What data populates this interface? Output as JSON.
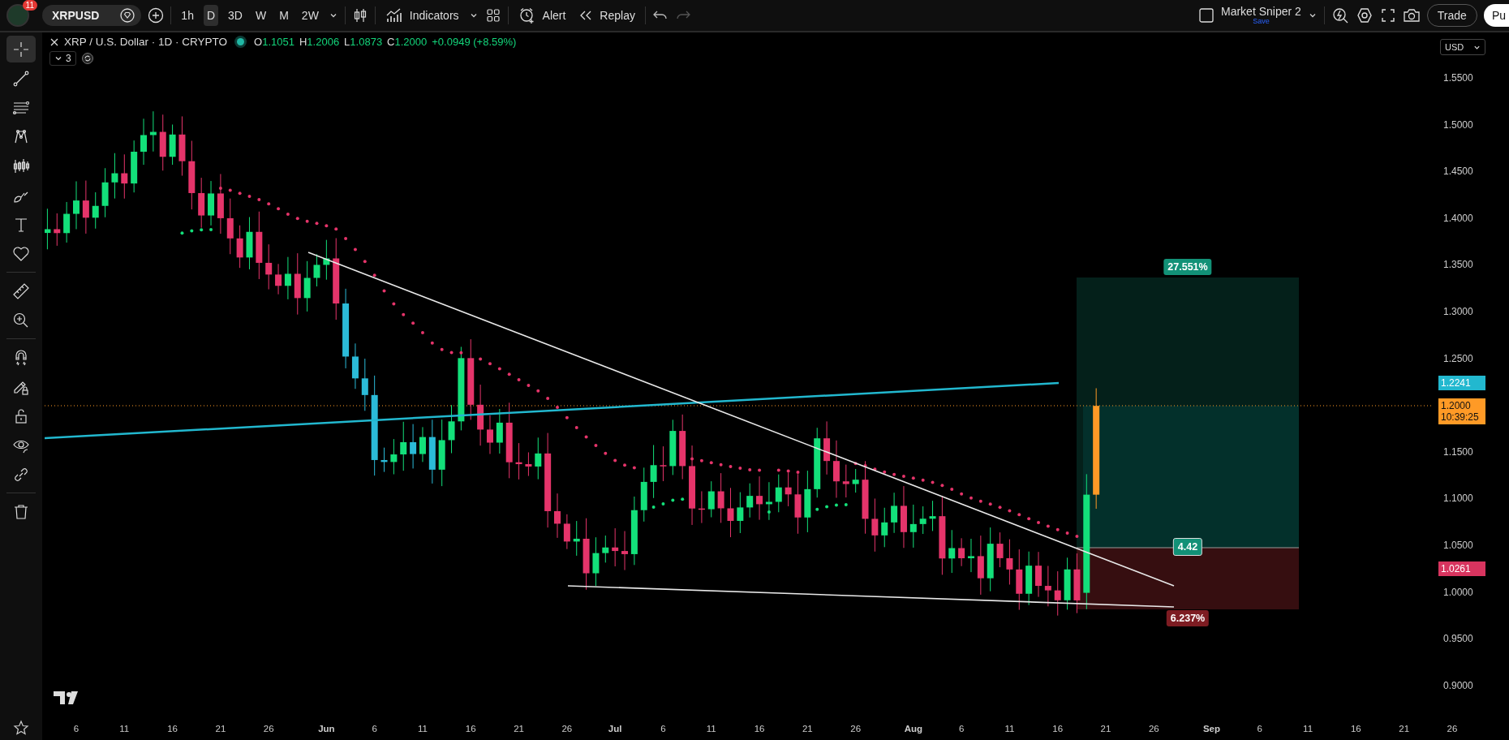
{
  "header": {
    "notification_count": "11",
    "symbol": "XRPUSD",
    "intervals": [
      {
        "label": "1h",
        "selected": false
      },
      {
        "label": "D",
        "selected": true
      },
      {
        "label": "3D",
        "selected": false
      },
      {
        "label": "W",
        "selected": false
      },
      {
        "label": "M",
        "selected": false
      },
      {
        "label": "2W",
        "selected": false
      }
    ],
    "indicators": "Indicators",
    "alert": "Alert",
    "replay": "Replay",
    "layout_name": "Market Sniper 2",
    "save": "Save",
    "trade": "Trade",
    "publish": "Pu"
  },
  "toolbar": {
    "tools": [
      {
        "kind": "crosshair",
        "selected": true
      },
      {
        "kind": "trend",
        "selected": false
      },
      {
        "kind": "fib",
        "selected": false
      },
      {
        "kind": "pattern",
        "selected": false
      },
      {
        "kind": "forecast",
        "selected": false
      },
      {
        "kind": "brush",
        "selected": false
      },
      {
        "kind": "text",
        "selected": false
      },
      {
        "kind": "heart",
        "selected": false
      },
      {
        "kind": "ruler",
        "selected": false
      },
      {
        "kind": "zoom",
        "selected": false
      },
      {
        "kind": "magnet",
        "selected": false
      },
      {
        "kind": "pencil-lock",
        "selected": false
      },
      {
        "kind": "lock",
        "selected": false
      },
      {
        "kind": "eye",
        "selected": false
      },
      {
        "kind": "link",
        "selected": false
      },
      {
        "kind": "trash",
        "selected": false
      }
    ]
  },
  "legend": {
    "title": "XRP / U.S. Dollar · 1D · CRYPTO",
    "ohlc": [
      {
        "label": "O",
        "value": "1.1051"
      },
      {
        "label": "H",
        "value": "1.2006"
      },
      {
        "label": "L",
        "value": "1.0873"
      },
      {
        "label": "C",
        "value": "1.2000"
      }
    ],
    "change": "+0.0949 (+8.59%)",
    "indicator_count": "3"
  },
  "price_axis": {
    "currency": "USD",
    "ticks": [
      "1.5500",
      "1.5000",
      "1.4500",
      "1.4000",
      "1.3500",
      "1.3000",
      "1.2500",
      "1.1500",
      "1.1000",
      "1.0500",
      "1.0000",
      "0.9500",
      "0.9000"
    ],
    "labels": [
      {
        "kind": "line",
        "text": "1.2241",
        "color": "#22b8cf"
      },
      {
        "kind": "last",
        "text": "1.2000",
        "countdown": "10:39:25",
        "color": "#ff9a26"
      },
      {
        "kind": "stop",
        "text": "1.0261",
        "color": "#d8345f"
      }
    ]
  },
  "position": {
    "target": "27.551%",
    "ratio": "4.42",
    "stop": "6.237%"
  },
  "time_axis": {
    "ticks": [
      {
        "label": "6",
        "kind": "day"
      },
      {
        "label": "11",
        "kind": "day"
      },
      {
        "label": "16",
        "kind": "day"
      },
      {
        "label": "21",
        "kind": "day"
      },
      {
        "label": "26",
        "kind": "day"
      },
      {
        "label": "Jun",
        "kind": "month"
      },
      {
        "label": "6",
        "kind": "day"
      },
      {
        "label": "11",
        "kind": "day"
      },
      {
        "label": "16",
        "kind": "day"
      },
      {
        "label": "21",
        "kind": "day"
      },
      {
        "label": "26",
        "kind": "day"
      },
      {
        "label": "Jul",
        "kind": "month"
      },
      {
        "label": "6",
        "kind": "day"
      },
      {
        "label": "11",
        "kind": "day"
      },
      {
        "label": "16",
        "kind": "day"
      },
      {
        "label": "21",
        "kind": "day"
      },
      {
        "label": "26",
        "kind": "day"
      },
      {
        "label": "Aug",
        "kind": "month"
      },
      {
        "label": "6",
        "kind": "day"
      },
      {
        "label": "11",
        "kind": "day"
      },
      {
        "label": "16",
        "kind": "day"
      },
      {
        "label": "21",
        "kind": "day"
      },
      {
        "label": "26",
        "kind": "day"
      },
      {
        "label": "Sep",
        "kind": "month"
      },
      {
        "label": "6",
        "kind": "day"
      },
      {
        "label": "11",
        "kind": "day"
      },
      {
        "label": "16",
        "kind": "day"
      },
      {
        "label": "21",
        "kind": "day"
      },
      {
        "label": "26",
        "kind": "day"
      }
    ]
  }
}
